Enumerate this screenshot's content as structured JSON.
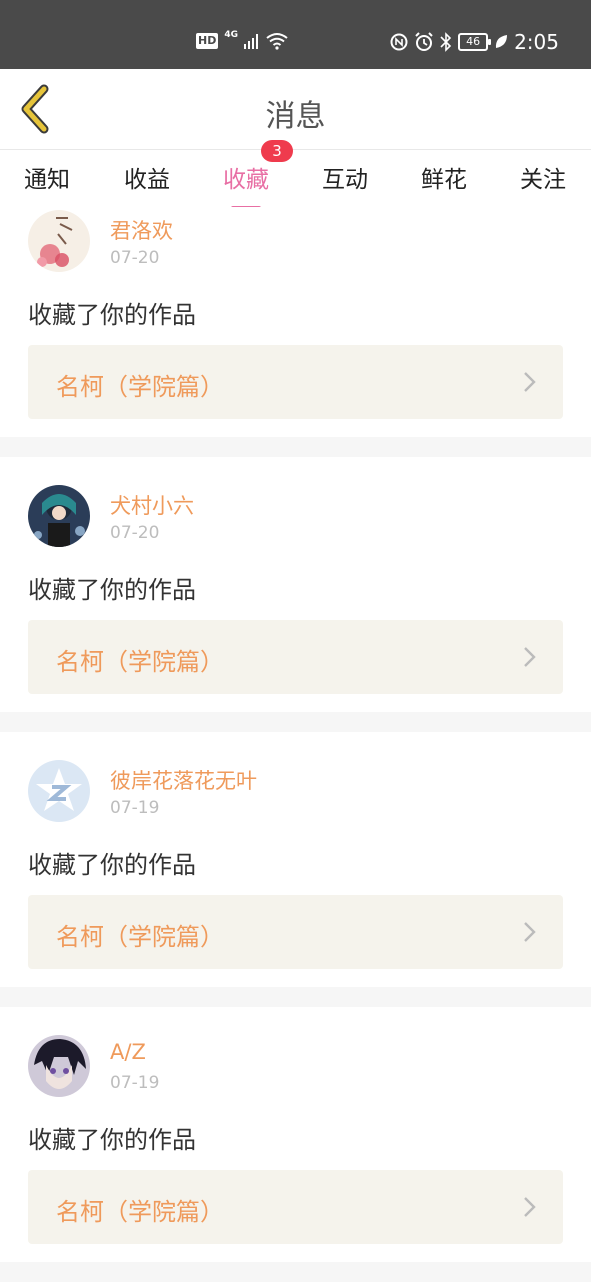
{
  "status_bar": {
    "hd": "HD",
    "network": "4G",
    "battery": "46",
    "time": "2:05"
  },
  "header": {
    "title": "消息"
  },
  "tabs": [
    {
      "label": "通知"
    },
    {
      "label": "收益"
    },
    {
      "label": "收藏",
      "badge": "3",
      "active": true
    },
    {
      "label": "互动"
    },
    {
      "label": "鲜花"
    },
    {
      "label": "关注"
    }
  ],
  "feed": [
    {
      "name": "君洛欢",
      "date": "07-20",
      "action": "收藏了你的作品",
      "work": "名柯（学院篇）"
    },
    {
      "name": "犬村小六",
      "date": "07-20",
      "action": "收藏了你的作品",
      "work": "名柯（学院篇）"
    },
    {
      "name": "彼岸花落花无叶",
      "date": "07-19",
      "action": "收藏了你的作品",
      "work": "名柯（学院篇）"
    },
    {
      "name": "A/Z",
      "date": "07-19",
      "action": "收藏了你的作品",
      "work": "名柯（学院篇）"
    }
  ],
  "colors": {
    "accent": "#e86fa4",
    "name": "#ef9a5b",
    "badge": "#ef3b4d",
    "back_icon": "#e6c43a"
  }
}
